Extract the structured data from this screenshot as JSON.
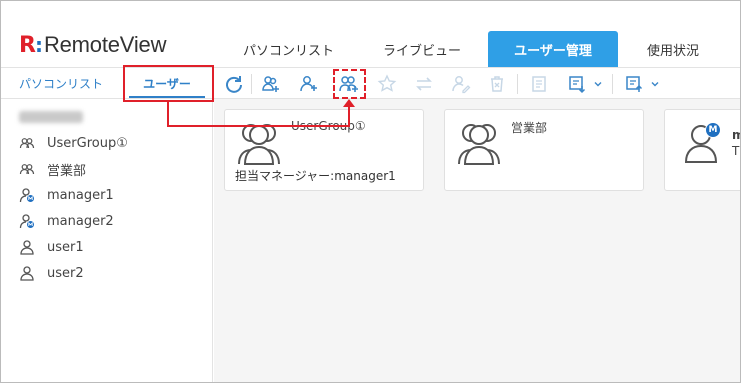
{
  "app": {
    "logo_mark": "R",
    "logo_colon": ":",
    "logo_text": "RemoteView"
  },
  "tabs": [
    {
      "label": "パソコンリスト"
    },
    {
      "label": "ライブビュー"
    },
    {
      "label": "ユーザー管理",
      "active": true
    },
    {
      "label": "使用状況"
    }
  ],
  "subtabs": [
    {
      "label": "パソコンリスト"
    },
    {
      "label": "ユーザー",
      "active": true
    }
  ],
  "toolbar": {
    "icons": [
      "refresh-icon",
      "add-group-icon",
      "add-user-icon",
      "add-manager-icon",
      "star-icon",
      "swap-icon",
      "edit-user-icon",
      "delete-icon",
      "log-icon",
      "import-icon",
      "export-icon"
    ]
  },
  "sidebar": {
    "items": [
      {
        "label": "UserGroup①",
        "icon": "group-icon"
      },
      {
        "label": "営業部",
        "icon": "group-icon"
      },
      {
        "label": "manager1",
        "icon": "manager-icon"
      },
      {
        "label": "manager2",
        "icon": "manager-icon"
      },
      {
        "label": "user1",
        "icon": "user-icon"
      },
      {
        "label": "user2",
        "icon": "user-icon"
      }
    ]
  },
  "cards": [
    {
      "name": "UserGroup①",
      "sub": "担当マネージャー:manager1"
    },
    {
      "name": "営業部",
      "sub": ""
    },
    {
      "name": "m",
      "sub": "T",
      "badge": "M"
    }
  ],
  "colors": {
    "accent": "#2f9fe6",
    "brand_red": "#e0202a",
    "brand_blue": "#1f6fc0",
    "highlight": "#e0202a"
  }
}
